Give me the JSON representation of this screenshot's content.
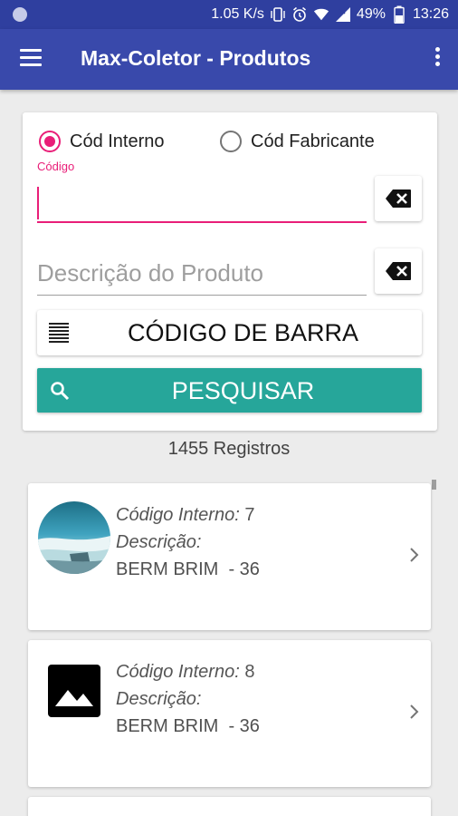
{
  "status_bar": {
    "speed": "1.05 K/s",
    "battery": "49%",
    "time": "13:26"
  },
  "app_bar": {
    "title": "Max-Coletor - Produtos"
  },
  "search_form": {
    "radio_internal": "Cód Interno",
    "radio_manufacturer": "Cód Fabricante",
    "selected_radio": "Cód Interno",
    "code_label": "Código",
    "code_value": "",
    "description_placeholder": "Descrição do Produto",
    "barcode_button": "CÓDIGO DE BARRA",
    "search_button": "PESQUISAR"
  },
  "results": {
    "count_text": "1455 Registros",
    "items": [
      {
        "code_label": "Código Interno:",
        "code": "7",
        "desc_label": "Descrição:",
        "description": "BERM BRIM  - 36",
        "image": "photo-thumbnail"
      },
      {
        "code_label": "Código Interno:",
        "code": "8",
        "desc_label": "Descrição:",
        "description": "BERM BRIM  - 36",
        "image": "image-placeholder-icon"
      }
    ]
  },
  "colors": {
    "app_bar": "#3949ab",
    "status_bar": "#2f3f9f",
    "accent": "#e91e78",
    "search_button": "#26a69a"
  }
}
